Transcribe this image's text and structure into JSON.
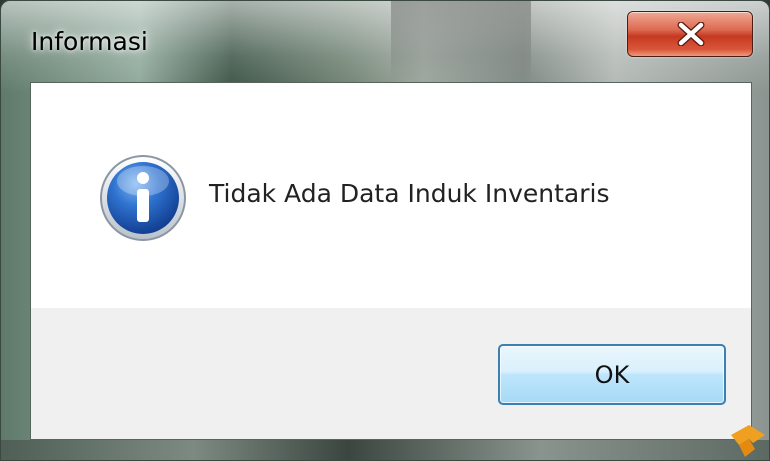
{
  "window": {
    "title": "Informasi"
  },
  "dialog": {
    "icon": "info-icon",
    "message": "Tidak Ada Data Induk Inventaris"
  },
  "buttons": {
    "ok_label": "OK",
    "close_icon": "close-icon"
  },
  "colors": {
    "close_button": "#c53a22",
    "ok_border": "#3c7fb1",
    "info_icon_blue": "#1f5fbf",
    "button_bar": "#f0f0f0"
  }
}
